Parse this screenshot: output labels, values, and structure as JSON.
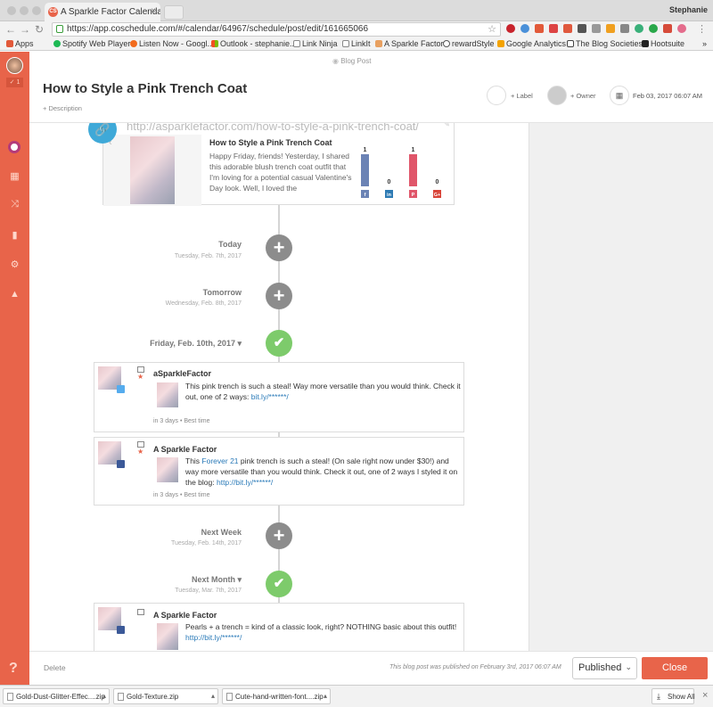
{
  "browser": {
    "tab_title": "A Sparkle Factor Calendar - Co",
    "user": "Stephanie",
    "url": "https://app.coschedule.com/#/calendar/64967/schedule/post/edit/161665066",
    "bookmarks": [
      "Apps",
      "Spotify Web Player",
      "Listen Now - Googl...",
      "Outlook - stephanie...",
      "Link Ninja",
      "LinkIt",
      "A Sparkle Factor",
      "rewardStyle",
      "Google Analytics",
      "The Blog Societies",
      "Hootsuite"
    ],
    "bookmarks_more": "»"
  },
  "header": {
    "type": "Blog Post",
    "title": "How to Style a Pink Trench Coat",
    "description": "+ Description",
    "label": "+ Label",
    "owner": "+ Owner",
    "date": "Feb 03, 2017 06:07 AM"
  },
  "sidebar": {
    "badge": "✓ 1",
    "help": "?"
  },
  "preview": {
    "url": "http://asparklefactor.com/how-to-style-a-pink-trench-coat/",
    "title": "How to Style a Pink Trench Coat",
    "excerpt": "Happy Friday, friends! Yesterday, I shared this adorable blush trench coat outfit that I'm loving for a potential casual Valentine's Day look. Well, I loved the",
    "shares": [
      {
        "network": "facebook",
        "count": 1,
        "color": "#6b83b5",
        "glyph": "f"
      },
      {
        "network": "linkedin",
        "count": 0,
        "color": "#2e7bb4",
        "glyph": "in"
      },
      {
        "network": "pinterest",
        "count": 1,
        "color": "#e0566a",
        "glyph": "P"
      },
      {
        "network": "googleplus",
        "count": 0,
        "color": "#d9453a",
        "glyph": "G+"
      }
    ]
  },
  "timeline": {
    "today": {
      "label": "Today",
      "date": "Tuesday, Feb. 7th, 2017"
    },
    "tomorrow": {
      "label": "Tomorrow",
      "date": "Wednesday, Feb. 8th, 2017"
    },
    "friday": {
      "label": "Friday, Feb. 10th, 2017"
    },
    "next_week": {
      "label": "Next Week",
      "date": "Tuesday, Feb. 14th, 2017"
    },
    "next_month": {
      "label": "Next Month",
      "date": "Tuesday, Mar. 7th, 2017"
    }
  },
  "messages": [
    {
      "account": "aSparkleFactor",
      "network": "twitter",
      "text": "This pink trench is such a steal! Way more versatile than you would think. Check it out, one of 2 ways: ",
      "link": "bit.ly/******/",
      "meta": "in 3 days • Best time"
    },
    {
      "account": "A Sparkle Factor",
      "network": "facebook",
      "text_pre": "This ",
      "brand": "Forever 21",
      "text_post": " pink trench is such a steal! (On sale right now under $30!) and way more versatile than you would think. Check it out, one of 2 ways I styled it on the blog: ",
      "link": "http://bit.ly/******/",
      "meta": "in 3 days • Best time"
    },
    {
      "account": "A Sparkle Factor",
      "network": "facebook",
      "text": "Pearls + a trench = kind of a classic look, right? NOTHING basic about this outfit! ",
      "link": "http://bit.ly/******/"
    }
  ],
  "footer": {
    "delete": "Delete",
    "status": "This blog post was published on February 3rd, 2017 06:07 AM",
    "select": "Published",
    "close": "Close"
  },
  "downloads": {
    "files": [
      "Gold-Dust-Glitter-Effec....zip",
      "Gold-Texture.zip",
      "Cute-hand-written-font....zip"
    ],
    "show_all": "Show All"
  }
}
